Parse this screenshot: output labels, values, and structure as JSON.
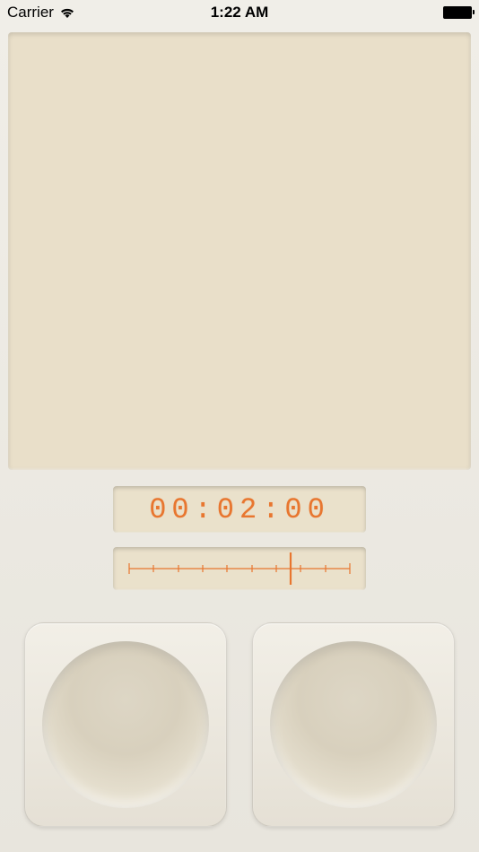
{
  "status_bar": {
    "carrier": "Carrier",
    "time": "1:22 AM"
  },
  "timer": {
    "display": "00:02:00"
  },
  "scale": {
    "position_percent": 73,
    "ticks": 10
  }
}
